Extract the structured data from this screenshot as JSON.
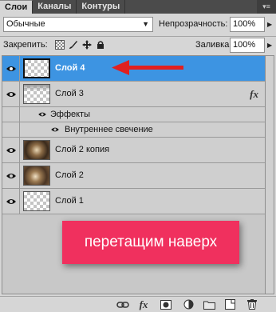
{
  "tabs": [
    {
      "label": "Слои",
      "active": true
    },
    {
      "label": "Каналы",
      "active": false
    },
    {
      "label": "Контуры",
      "active": false
    }
  ],
  "options": {
    "blend_mode": "Обычные",
    "opacity_label": "Непрозрачность:",
    "opacity_value": "100%",
    "lock_label": "Закрепить:",
    "fill_label": "Заливка:",
    "fill_value": "100%"
  },
  "layers": [
    {
      "name": "Слой 4",
      "selected": true,
      "thumb": "transparent",
      "visible": true
    },
    {
      "name": "Слой 3",
      "selected": false,
      "thumb": "transparent-gradient",
      "visible": true,
      "fx": "fx",
      "effects_label": "Эффекты",
      "effect_item": "Внутреннее свечение"
    },
    {
      "name": "Слой 2 копия",
      "selected": false,
      "thumb": "photo",
      "visible": true
    },
    {
      "name": "Слой 2",
      "selected": false,
      "thumb": "photo",
      "visible": true
    },
    {
      "name": "Слой 1",
      "selected": false,
      "thumb": "transparent",
      "visible": true
    }
  ],
  "annotation": {
    "text": "перетащим наверх",
    "color": "#f0305e",
    "arrow_color": "#e02020"
  },
  "colors": {
    "selection": "#3d94e2"
  },
  "toolbar_icons": [
    "link-icon",
    "fx-icon",
    "mask-icon",
    "adjustment-icon",
    "folder-icon",
    "new-layer-icon",
    "trash-icon"
  ]
}
